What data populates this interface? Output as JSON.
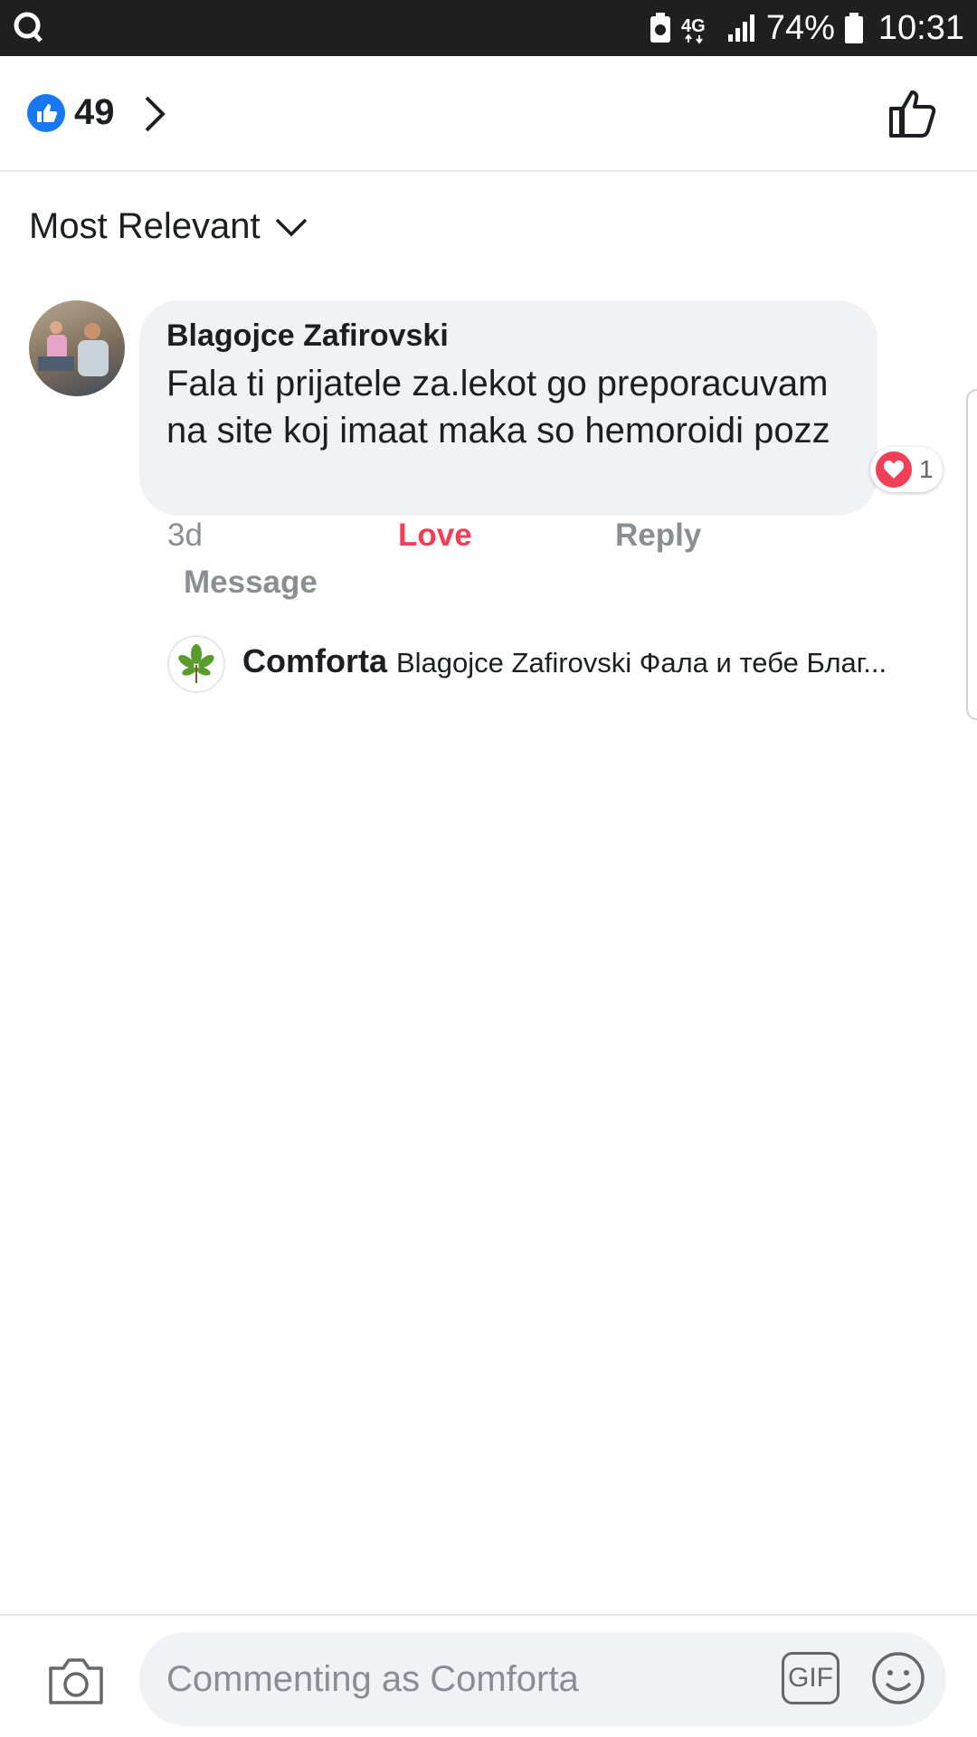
{
  "status_bar": {
    "app_icon": "q-icon",
    "network": "4G",
    "battery_percent": "74%",
    "time": "10:31"
  },
  "header": {
    "like_count": "49",
    "like_icon": "thumbs-up-icon"
  },
  "sort": {
    "label": "Most Relevant"
  },
  "comment": {
    "author": "Blagojce Zafirovski",
    "text": "Fala ti prijatele za.lekot go preporacuvam na site koj imaat maka so hemoroidi pozz",
    "reaction_count": "1",
    "time": "3d",
    "love_label": "Love",
    "reply_label": "Reply",
    "message_label": "Message"
  },
  "reply": {
    "author": "Comforta",
    "text": "Blagojce Zafirovski Фала и тебе Благ..."
  },
  "composer": {
    "placeholder": "Commenting as Comforta",
    "gif_label": "GIF"
  },
  "colors": {
    "facebook_blue": "#1877f2",
    "love_red": "#f33e58",
    "bubble_gray": "#f0f2f5"
  }
}
